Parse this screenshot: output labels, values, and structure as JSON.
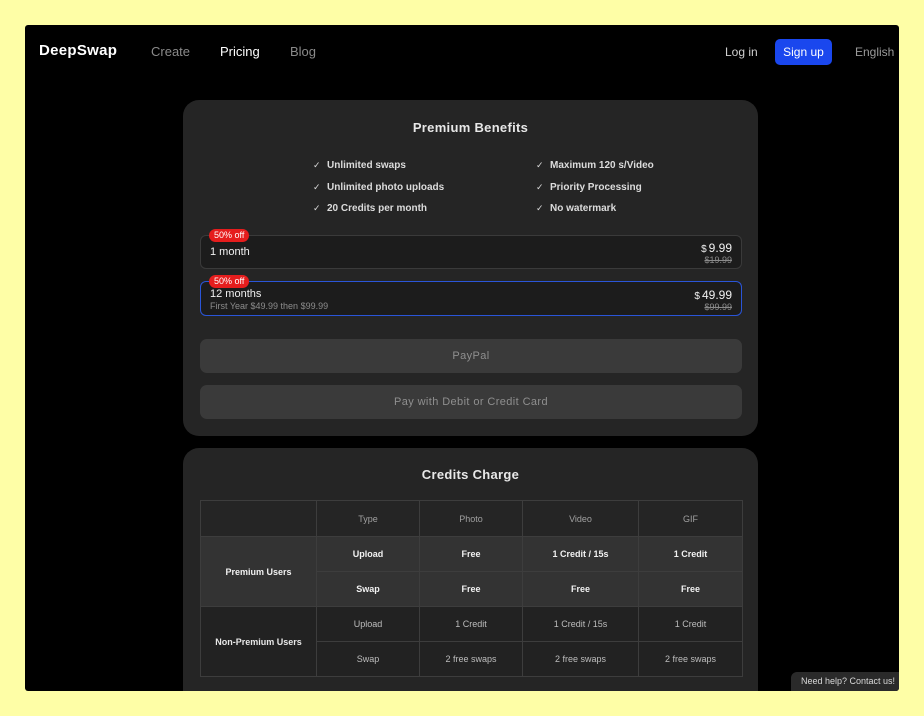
{
  "header": {
    "logo": "DeepSwap",
    "nav": [
      {
        "label": "Create"
      },
      {
        "label": "Pricing"
      },
      {
        "label": "Blog"
      }
    ],
    "login_label": "Log in",
    "signup_label": "Sign up",
    "language": "English"
  },
  "benefits": {
    "title": "Premium Benefits",
    "left": [
      "Unlimited swaps",
      "Unlimited photo uploads",
      "20 Credits per month"
    ],
    "right": [
      "Maximum 120 s/Video",
      "Priority Processing",
      "No watermark"
    ]
  },
  "plans": [
    {
      "badge": "50% off",
      "name": "1 month",
      "subtitle": "",
      "currency": "$",
      "price": "9.99",
      "old_price": "$19.99",
      "selected": false
    },
    {
      "badge": "50% off",
      "name": "12 months",
      "subtitle": "First Year $49.99 then $99.99",
      "currency": "$",
      "price": "49.99",
      "old_price": "$99.99",
      "selected": true
    }
  ],
  "payment": {
    "paypal_label": "PayPal",
    "card_label": "Pay with Debit or Credit Card"
  },
  "credits": {
    "title": "Credits Charge",
    "headers": [
      "",
      "Type",
      "Photo",
      "Video",
      "GIF"
    ],
    "groups": [
      {
        "name": "Premium Users",
        "rows": [
          [
            "Upload",
            "Free",
            "1 Credit /  15s",
            "1 Credit"
          ],
          [
            "Swap",
            "Free",
            "Free",
            "Free"
          ]
        ]
      },
      {
        "name": "Non-Premium Users",
        "rows": [
          [
            "Upload",
            "1 Credit",
            "1 Credit /  15s",
            "1 Credit"
          ],
          [
            "Swap",
            "2 free swaps",
            "2 free swaps",
            "2 free swaps"
          ]
        ]
      }
    ]
  },
  "help_label": "Need help? Contact us!",
  "colors": {
    "page_bg": "#fefea6",
    "screen_bg": "#000000",
    "card_bg": "#252525",
    "accent": "#1a47ee",
    "badge": "#e51d1d",
    "selected_border": "#2a55d8"
  }
}
